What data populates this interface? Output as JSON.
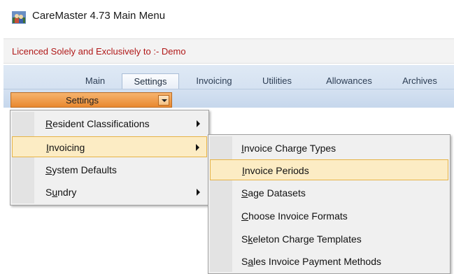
{
  "window": {
    "title": "CareMaster 4.73 Main Menu",
    "icon": "caremaster-app-icon"
  },
  "licence": {
    "text": "Licenced Solely and Exclusively to :- Demo"
  },
  "ribbon": {
    "tabs": [
      {
        "label": "Main"
      },
      {
        "label": "Settings",
        "active": true
      },
      {
        "label": "Invoicing"
      },
      {
        "label": "Utilities"
      },
      {
        "label": "Allowances"
      },
      {
        "label": "Archives"
      }
    ],
    "dropdown": {
      "label": "Settings",
      "icon": "chevron-down-icon"
    }
  },
  "settings_menu": {
    "items": [
      {
        "label": "Resident Classifications",
        "mnemonic": "R",
        "has_submenu": true
      },
      {
        "label": "Invoicing",
        "mnemonic": "I",
        "has_submenu": true,
        "highlighted": true
      },
      {
        "label": "System Defaults",
        "mnemonic": "S",
        "has_submenu": false
      },
      {
        "label": "Sundry",
        "mnemonic": "u",
        "has_submenu": true
      }
    ]
  },
  "invoicing_submenu": {
    "items": [
      {
        "label": "Invoice Charge Types",
        "mnemonic": "I"
      },
      {
        "label": "Invoice Periods",
        "mnemonic": "I",
        "highlighted": true
      },
      {
        "label": "Sage Datasets",
        "mnemonic": "S"
      },
      {
        "label": "Choose Invoice Formats",
        "mnemonic": "C"
      },
      {
        "label": "Skeleton Charge Templates",
        "mnemonic": "k"
      },
      {
        "label": "Sales Invoice Payment Methods",
        "mnemonic": "a"
      }
    ]
  },
  "colors": {
    "licence_text": "#b01818",
    "ribbon_blue": "#cddcee",
    "settings_orange": "#e9892f",
    "menu_highlight": "#fcecc4",
    "menu_highlight_border": "#e6b347"
  }
}
